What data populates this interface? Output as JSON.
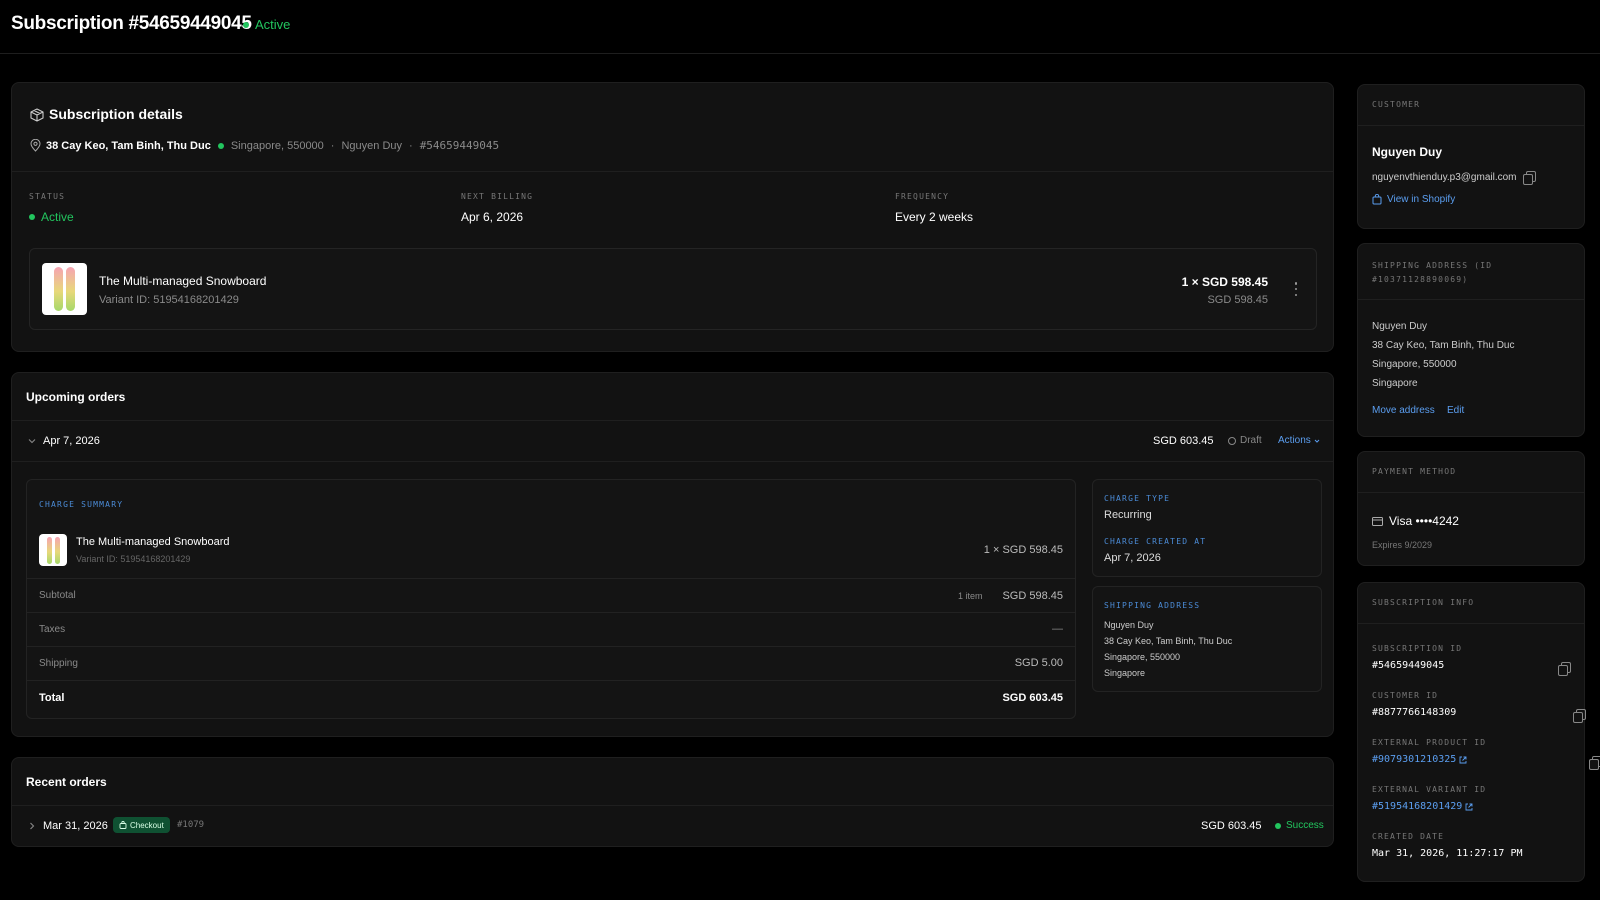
{
  "header": {
    "title": "Subscription #54659449045",
    "status": "Active"
  },
  "details": {
    "title": "Subscription details",
    "address": "38 Cay Keo, Tam Binh, Thu Duc",
    "city": "Singapore, 550000",
    "customer": "Nguyen Duy",
    "id": "#54659449045",
    "status_label": "STATUS",
    "status_value": "Active",
    "billing_label": "NEXT BILLING",
    "billing_value": "Apr 6, 2026",
    "freq_label": "FREQUENCY",
    "freq_value": "Every 2 weeks",
    "product_name": "The Multi-managed Snowboard",
    "variant": "Variant ID: 51954168201429",
    "qty_price": "1 × SGD 598.45",
    "line_total": "SGD 598.45"
  },
  "upcoming": {
    "title": "Upcoming orders",
    "date": "Apr 7, 2026",
    "amount": "SGD 603.45",
    "status": "Draft",
    "actions": "Actions",
    "charge_summary_label": "CHARGE SUMMARY",
    "product_name": "The Multi-managed Snowboard",
    "variant": "Variant ID: 51954168201429",
    "qty_price": "1 × SGD 598.45",
    "subtotal_label": "Subtotal",
    "subtotal_items": "1 item",
    "subtotal_value": "SGD 598.45",
    "taxes_label": "Taxes",
    "taxes_value": "—",
    "shipping_label": "Shipping",
    "shipping_value": "SGD 5.00",
    "total_label": "Total",
    "total_value": "SGD 603.45",
    "charge_type_label": "CHARGE TYPE",
    "charge_type_value": "Recurring",
    "charge_created_label": "CHARGE CREATED AT",
    "charge_created_value": "Apr 7, 2026",
    "ship_label": "SHIPPING ADDRESS",
    "ship_name": "Nguyen Duy",
    "ship_line1": "38 Cay Keo, Tam Binh, Thu Duc",
    "ship_line2": "Singapore, 550000",
    "ship_line3": "Singapore"
  },
  "recent": {
    "title": "Recent orders",
    "date": "Mar 31, 2026",
    "badge": "Checkout",
    "order": "#1079",
    "amount": "SGD 603.45",
    "status": "Success"
  },
  "customer": {
    "label": "CUSTOMER",
    "name": "Nguyen Duy",
    "email": "nguyenvthienduy.p3@gmail.com",
    "shopify": "View in Shopify"
  },
  "shipping": {
    "label": "SHIPPING ADDRESS (ID #10371128890069)",
    "name": "Nguyen Duy",
    "line1": "38 Cay Keo, Tam Binh, Thu Duc",
    "line2": "Singapore, 550000",
    "line3": "Singapore",
    "move": "Move address",
    "edit": "Edit"
  },
  "payment": {
    "label": "PAYMENT METHOD",
    "card": "Visa ••••4242",
    "expires": "Expires 9/2029"
  },
  "info": {
    "label": "SUBSCRIPTION INFO",
    "sub_id_label": "SUBSCRIPTION ID",
    "sub_id": "#54659449045",
    "cust_id_label": "CUSTOMER ID",
    "cust_id": "#8877766148309",
    "prod_id_label": "EXTERNAL PRODUCT ID",
    "prod_id": "#9079301210325",
    "var_id_label": "EXTERNAL VARIANT ID",
    "var_id": "#51954168201429",
    "created_label": "CREATED DATE",
    "created": "Mar 31, 2026, 11:27:17 PM"
  }
}
